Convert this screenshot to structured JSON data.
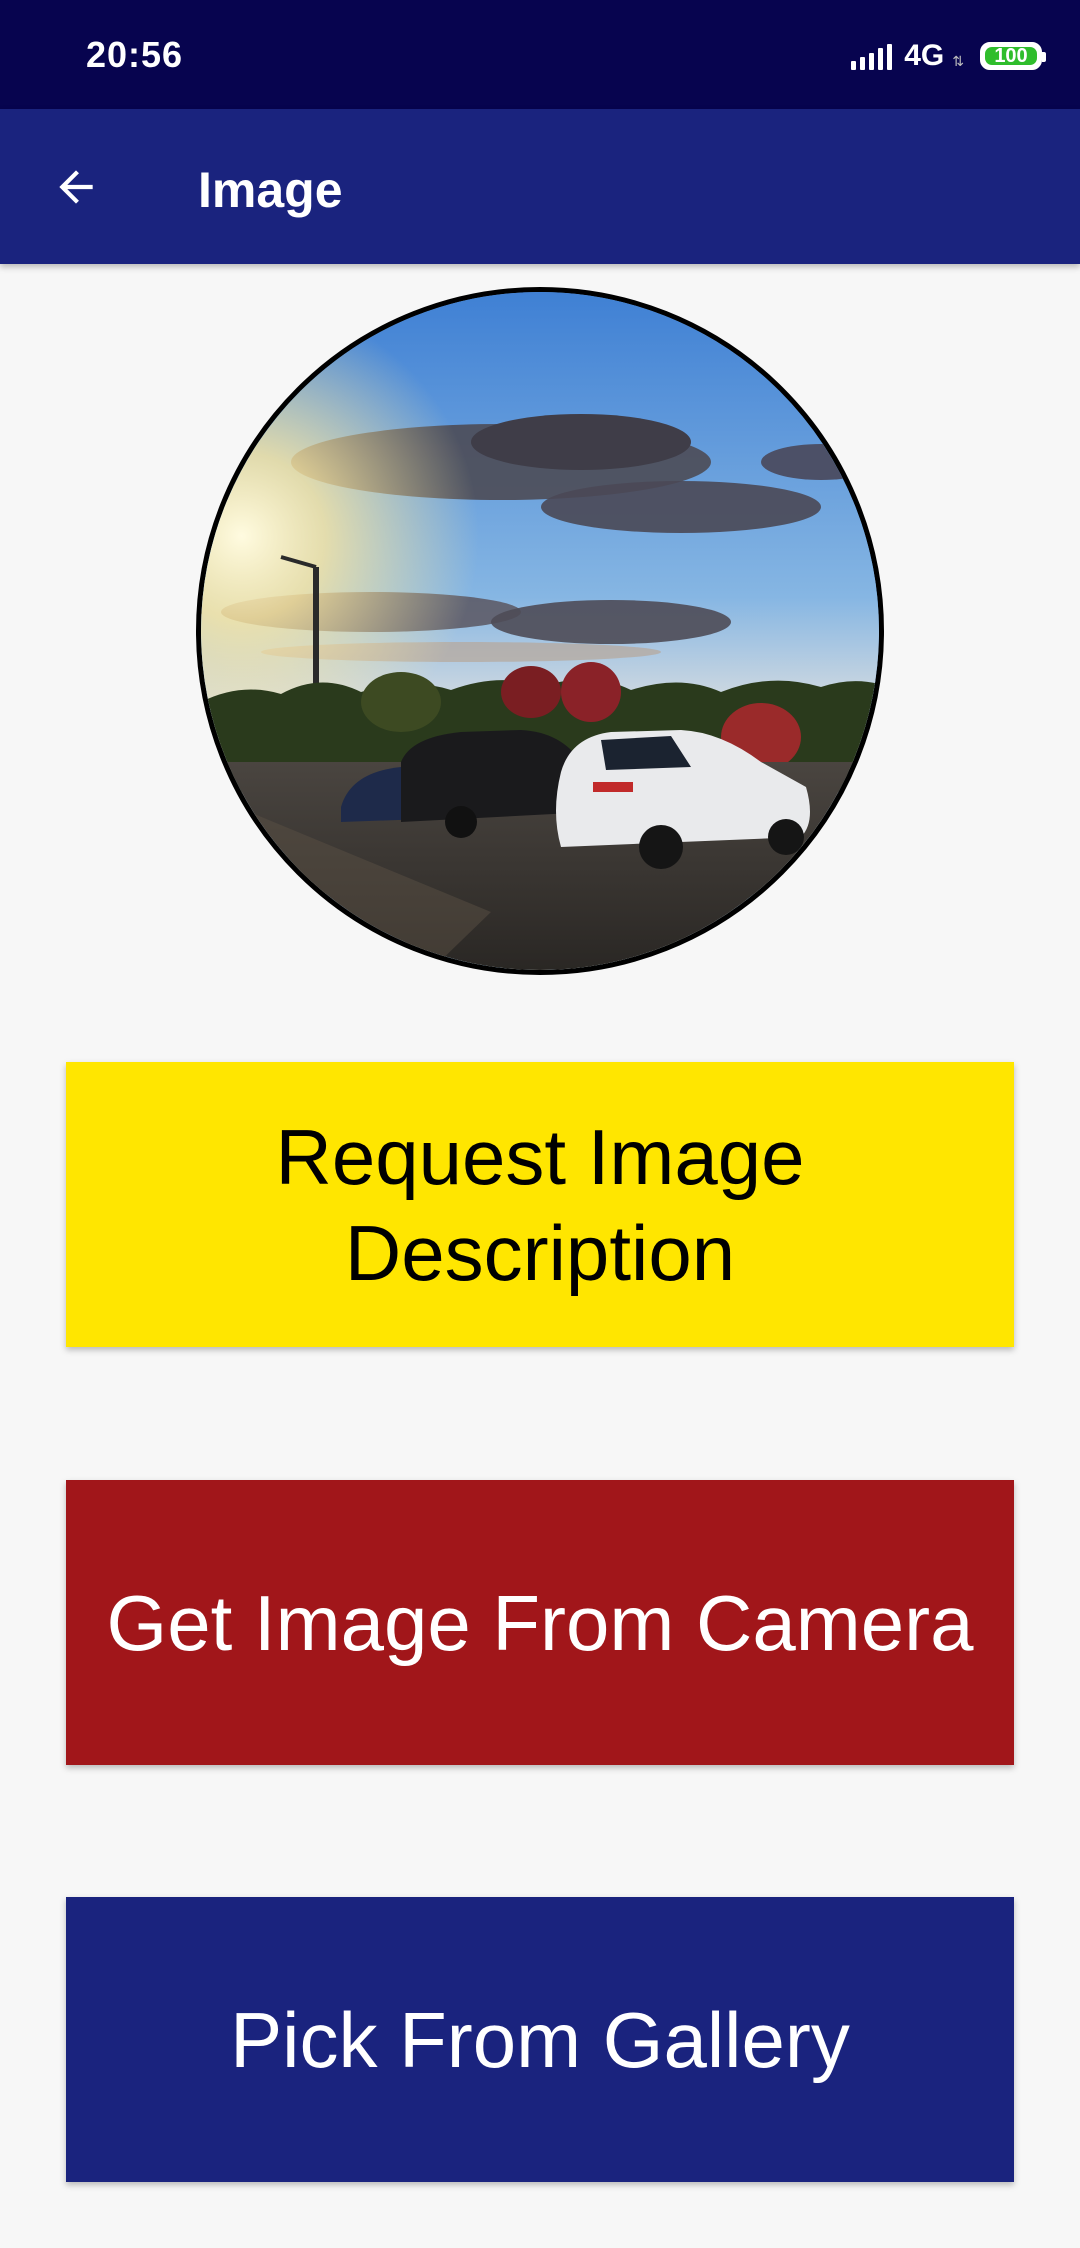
{
  "status_bar": {
    "time": "20:56",
    "network": "4G",
    "battery": "100",
    "signal_icon": "signal-bars-icon",
    "battery_icon": "battery-icon"
  },
  "app_bar": {
    "title": "Image",
    "back_icon": "arrow-back-icon"
  },
  "image": {
    "shape": "circle",
    "border_color": "#000000"
  },
  "buttons": {
    "describe": "Request Image Description",
    "camera": "Get Image From Camera",
    "gallery": "Pick From Gallery"
  },
  "colors": {
    "status_bar": "#07044f",
    "app_bar": "#1a237e",
    "describe_button": "#ffe600",
    "camera_button": "#a1161a",
    "gallery_button": "#1a237e",
    "background": "#f7f7f7"
  }
}
